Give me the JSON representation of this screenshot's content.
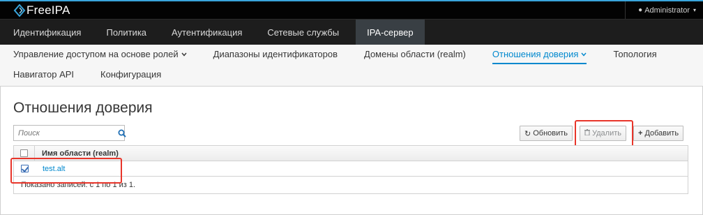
{
  "app": {
    "brand": "FreeIPA",
    "logo_icon": "freeipa-logo-icon"
  },
  "user_menu": {
    "label": "Administrator",
    "icon": "user-icon",
    "caret": "▾"
  },
  "primary_nav": [
    {
      "label": "Идентификация",
      "active": false
    },
    {
      "label": "Политика",
      "active": false
    },
    {
      "label": "Аутентификация",
      "active": false
    },
    {
      "label": "Сетевые службы",
      "active": false
    },
    {
      "label": "IPA-сервер",
      "active": true
    }
  ],
  "secondary_nav": {
    "row1": [
      {
        "label": "Управление доступом на основе ролей",
        "dropdown": true,
        "active": false
      },
      {
        "label": "Диапазоны идентификаторов",
        "dropdown": false,
        "active": false
      },
      {
        "label": "Домены области (realm)",
        "dropdown": false,
        "active": false
      },
      {
        "label": "Отношения доверия",
        "dropdown": true,
        "active": true
      },
      {
        "label": "Топология",
        "dropdown": false,
        "active": false
      }
    ],
    "row2": [
      {
        "label": "Навигатор API",
        "dropdown": false,
        "active": false
      },
      {
        "label": "Конфигурация",
        "dropdown": false,
        "active": false
      }
    ]
  },
  "page": {
    "title": "Отношения доверия"
  },
  "search": {
    "placeholder": "Поиск",
    "value": "",
    "icon": "search-icon"
  },
  "toolbar": {
    "refresh_label": "Обновить",
    "delete_label": "Удалить",
    "add_label": "Добавить"
  },
  "table": {
    "columns": [
      "Имя области (realm)"
    ],
    "rows": [
      {
        "realm": "test.alt",
        "selected": true
      }
    ],
    "footer": "Показано записей: с 1 по 1 из 1."
  },
  "colors": {
    "accent": "#0088ce",
    "topbar": "#030303",
    "nav": "#1d1d1d",
    "active_tab": "#393f44",
    "highlight": "#e8352a"
  }
}
